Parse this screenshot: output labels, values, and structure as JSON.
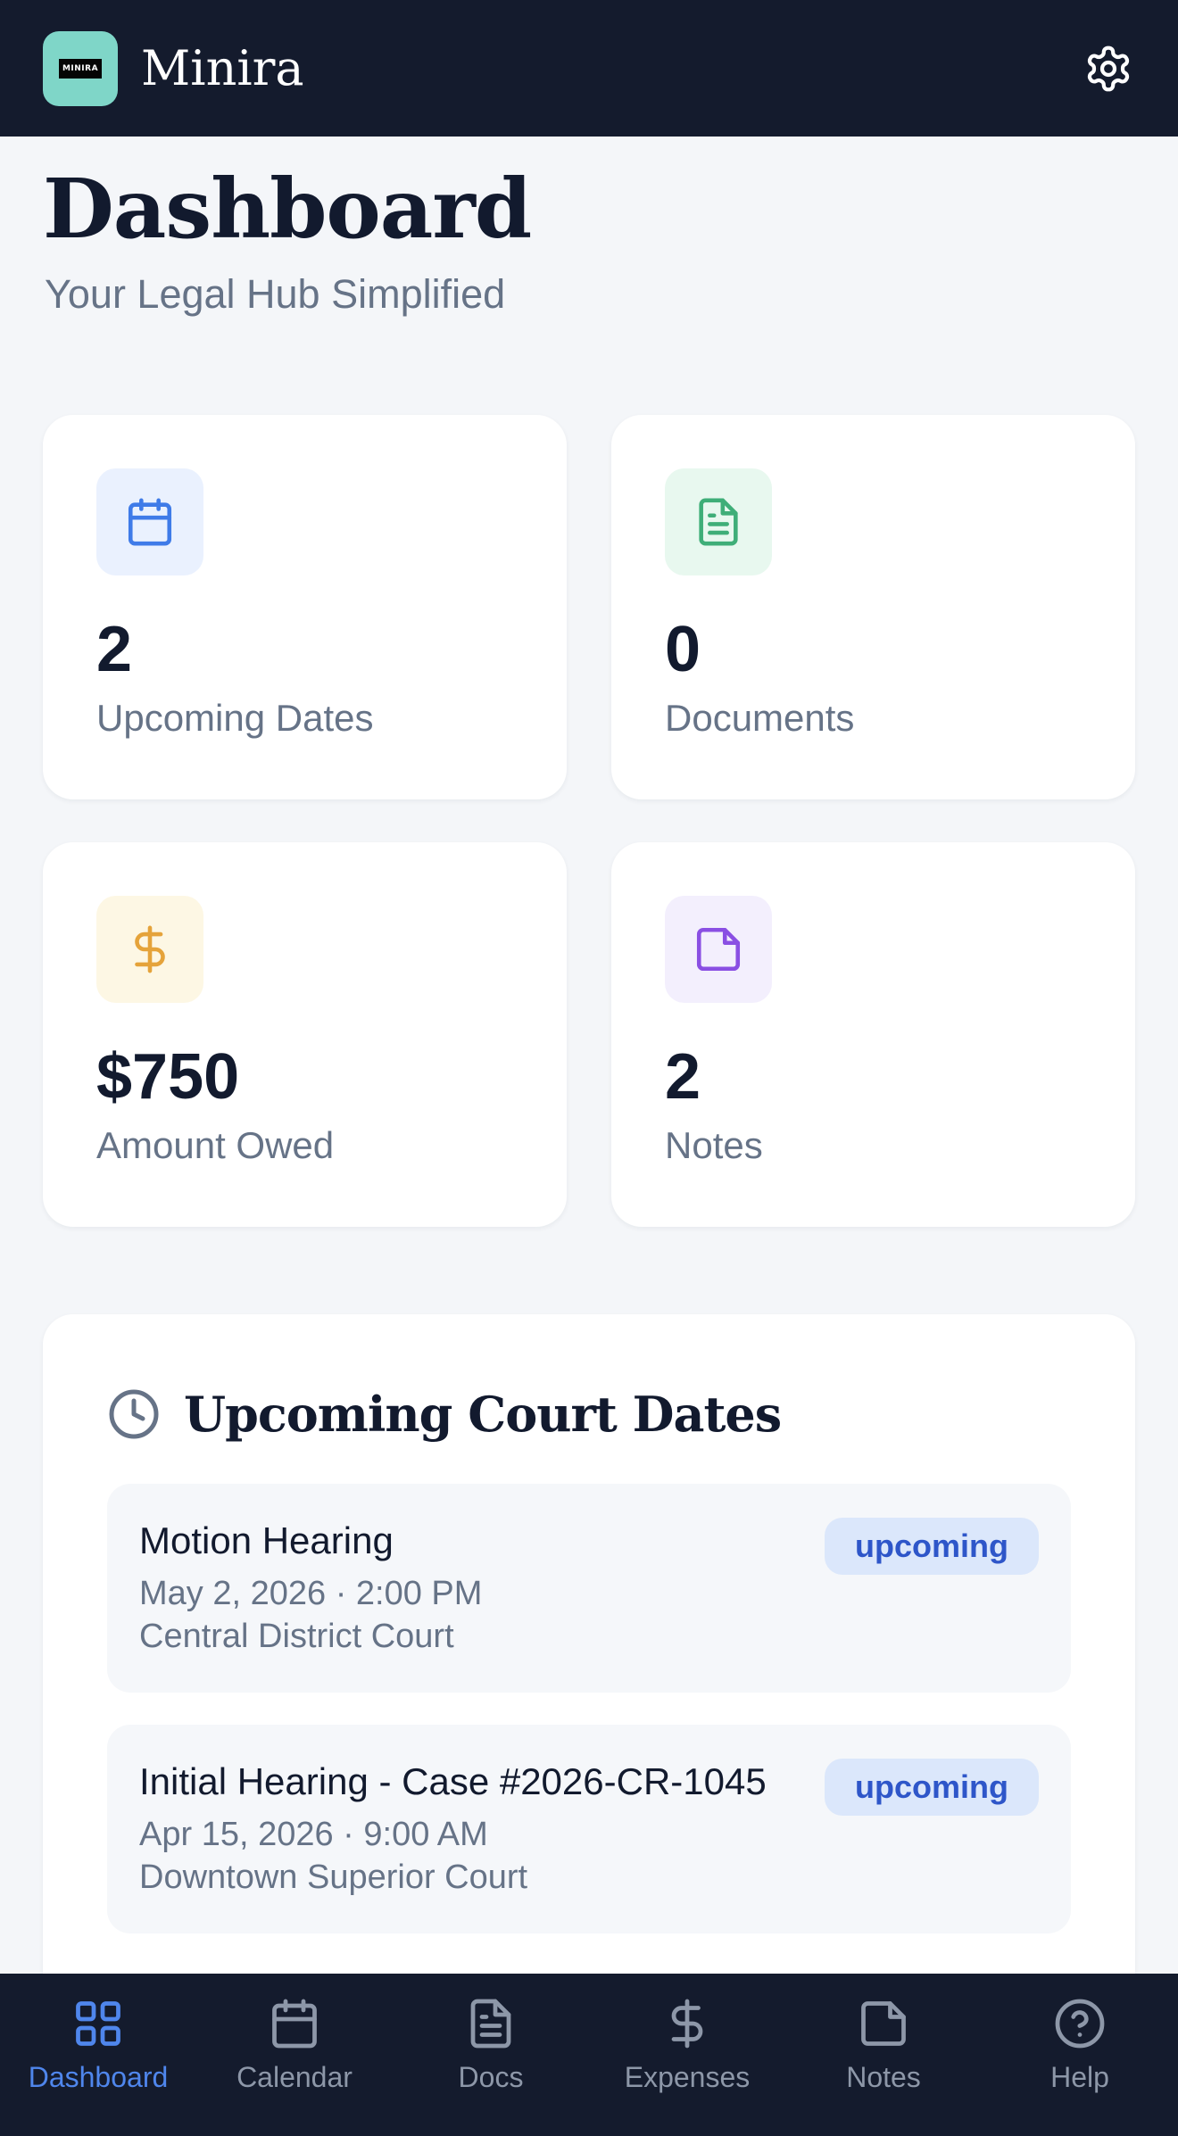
{
  "app": {
    "name": "Minira",
    "logo_text": "MINIRA"
  },
  "header": {
    "title": "Dashboard",
    "subtitle": "Your Legal Hub Simplified"
  },
  "stats": [
    {
      "value": "2",
      "label": "Upcoming Dates",
      "icon": "calendar-icon",
      "color": "#3f7be8",
      "bg": "#eaf1fe"
    },
    {
      "value": "0",
      "label": "Documents",
      "icon": "document-icon",
      "color": "#3fae78",
      "bg": "#e8f8ef"
    },
    {
      "value": "$750",
      "label": "Amount Owed",
      "icon": "dollar-icon",
      "color": "#e5a33a",
      "bg": "#fdf7e4"
    },
    {
      "value": "2",
      "label": "Notes",
      "icon": "note-icon",
      "color": "#8a4fe3",
      "bg": "#f3effd"
    }
  ],
  "court_dates": {
    "title": "Upcoming Court Dates",
    "items": [
      {
        "title": "Motion Hearing",
        "date": "May 2, 2026 · 2:00 PM",
        "location": "Central District Court",
        "status": "upcoming"
      },
      {
        "title": "Initial Hearing - Case #2026-CR-1045",
        "date": "Apr 15, 2026 · 9:00 AM",
        "location": "Downtown Superior Court",
        "status": "upcoming"
      }
    ]
  },
  "nav": {
    "items": [
      {
        "label": "Dashboard",
        "icon": "grid-icon",
        "active": true
      },
      {
        "label": "Calendar",
        "icon": "calendar-icon"
      },
      {
        "label": "Docs",
        "icon": "document-icon"
      },
      {
        "label": "Expenses",
        "icon": "dollar-icon"
      },
      {
        "label": "Notes",
        "icon": "note-icon"
      },
      {
        "label": "Help",
        "icon": "help-icon"
      }
    ]
  },
  "colors": {
    "topbar": "#141b2d",
    "accent": "#4f86ec",
    "logo_bg": "#7fd6c8",
    "badge_bg": "#dbe7fb",
    "badge_text": "#2e56c9"
  }
}
